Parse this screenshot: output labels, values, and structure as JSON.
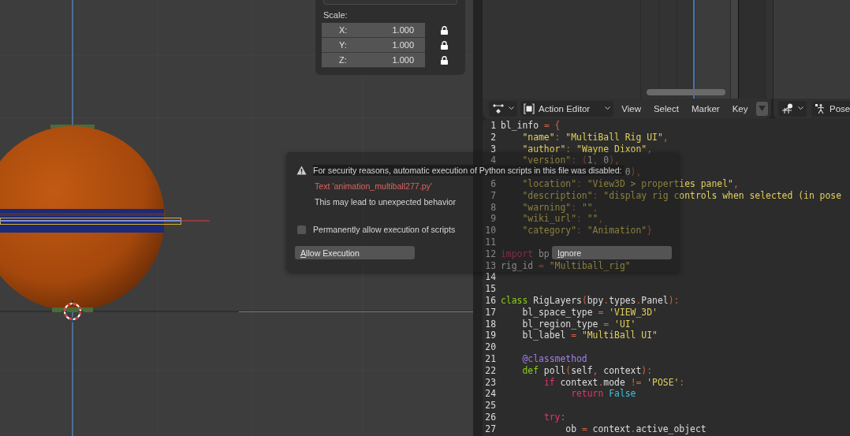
{
  "viewport": {
    "panel": {
      "heading": "Scale:",
      "fields": [
        {
          "axis": "X:",
          "value": "1.000",
          "locked": true
        },
        {
          "axis": "Y:",
          "value": "1.000",
          "locked": true
        },
        {
          "axis": "Z:",
          "value": "1.000",
          "locked": true
        }
      ]
    }
  },
  "dopesheet_header": {
    "editor_mode": "Action Editor",
    "menus": [
      "View",
      "Select",
      "Marker",
      "Key"
    ]
  },
  "pose_header": {
    "mode": "Pose"
  },
  "text_editor": {
    "lines": [
      {
        "number": "1",
        "tokens": [
          {
            "kind": "plain",
            "text": "bl_info "
          },
          {
            "kind": "operator",
            "text": "= {"
          }
        ]
      },
      {
        "number": "2",
        "tokens": [
          {
            "kind": "string",
            "text": "    \"name\""
          },
          {
            "kind": "operator",
            "text": ": "
          },
          {
            "kind": "string",
            "text": "\"MultiBall Rig UI\""
          },
          {
            "kind": "operator",
            "text": ","
          }
        ]
      },
      {
        "number": "3",
        "tokens": [
          {
            "kind": "string",
            "text": "    \"author\""
          },
          {
            "kind": "operator",
            "text": ": "
          },
          {
            "kind": "string",
            "text": "\"Wayne Dixon\""
          },
          {
            "kind": "operator",
            "text": ","
          }
        ]
      },
      {
        "number": "4",
        "tokens": [
          {
            "kind": "string",
            "text": "    \"version\""
          },
          {
            "kind": "operator",
            "text": ": ("
          },
          {
            "kind": "plain",
            "text": "1"
          },
          {
            "kind": "operator",
            "text": ", "
          },
          {
            "kind": "plain",
            "text": "0"
          },
          {
            "kind": "operator",
            "text": "),"
          }
        ]
      },
      {
        "tokens": [
          {
            "kind": "plain",
            "text": "                       0"
          },
          {
            "kind": "operator",
            "text": "),"
          }
        ]
      },
      {
        "number": "6",
        "tokens": [
          {
            "kind": "string",
            "text": "    \"location\""
          },
          {
            "kind": "operator",
            "text": ": "
          },
          {
            "kind": "string",
            "text": "\"View3D > properties panel\""
          },
          {
            "kind": "operator",
            "text": ","
          }
        ]
      },
      {
        "number": "7",
        "tokens": [
          {
            "kind": "string",
            "text": "    \"description\""
          },
          {
            "kind": "operator",
            "text": ": "
          },
          {
            "kind": "string",
            "text": "\"display rig controls when selected (in pose"
          }
        ]
      },
      {
        "number": "8",
        "tokens": [
          {
            "kind": "string",
            "text": "    \"warning\""
          },
          {
            "kind": "operator",
            "text": ": "
          },
          {
            "kind": "string",
            "text": "\"\""
          },
          {
            "kind": "operator",
            "text": ","
          }
        ]
      },
      {
        "number": "9",
        "tokens": [
          {
            "kind": "string",
            "text": "    \"wiki_url\""
          },
          {
            "kind": "operator",
            "text": ": "
          },
          {
            "kind": "string",
            "text": "\"\""
          },
          {
            "kind": "operator",
            "text": ","
          }
        ]
      },
      {
        "number": "10",
        "tokens": [
          {
            "kind": "string",
            "text": "    \"category\""
          },
          {
            "kind": "operator",
            "text": ": "
          },
          {
            "kind": "string",
            "text": "\"Animation\""
          },
          {
            "kind": "operator",
            "text": "}"
          }
        ]
      },
      {
        "number": "11"
      },
      {
        "number": "12",
        "tokens": [
          {
            "kind": "keyword",
            "text": "import"
          },
          {
            "kind": "plain",
            "text": " bp"
          }
        ]
      },
      {
        "number": "13",
        "tokens": [
          {
            "kind": "plain",
            "text": "rig_id "
          },
          {
            "kind": "operator",
            "text": "= "
          },
          {
            "kind": "string",
            "text": "\"Multiball_rig\""
          }
        ]
      },
      {
        "number": "14"
      },
      {
        "number": "15"
      },
      {
        "number": "16",
        "tokens": [
          {
            "kind": "definition",
            "text": "class"
          },
          {
            "kind": "plain",
            "text": " RigLayers"
          },
          {
            "kind": "operator",
            "text": "("
          },
          {
            "kind": "plain",
            "text": "bpy"
          },
          {
            "kind": "operator",
            "text": "."
          },
          {
            "kind": "plain",
            "text": "types"
          },
          {
            "kind": "operator",
            "text": "."
          },
          {
            "kind": "plain",
            "text": "Panel"
          },
          {
            "kind": "operator",
            "text": "):"
          }
        ]
      },
      {
        "number": "17",
        "tokens": [
          {
            "kind": "plain",
            "text": "    bl_space_type "
          },
          {
            "kind": "operator",
            "text": "= "
          },
          {
            "kind": "string",
            "text": "'VIEW_3D'"
          }
        ]
      },
      {
        "number": "18",
        "tokens": [
          {
            "kind": "plain",
            "text": "    bl_region_type "
          },
          {
            "kind": "operator",
            "text": "= "
          },
          {
            "kind": "string",
            "text": "'UI'"
          }
        ]
      },
      {
        "number": "19",
        "tokens": [
          {
            "kind": "plain",
            "text": "    bl_label "
          },
          {
            "kind": "operator",
            "text": "= "
          },
          {
            "kind": "string",
            "text": "\"MultiBall UI\""
          }
        ]
      },
      {
        "number": "20"
      },
      {
        "number": "21",
        "tokens": [
          {
            "kind": "decorator",
            "text": "    @classmethod"
          }
        ]
      },
      {
        "number": "22",
        "tokens": [
          {
            "kind": "definition",
            "text": "    def"
          },
          {
            "kind": "plain",
            "text": " poll"
          },
          {
            "kind": "operator",
            "text": "("
          },
          {
            "kind": "plain",
            "text": "self"
          },
          {
            "kind": "operator",
            "text": ", "
          },
          {
            "kind": "plain",
            "text": "context"
          },
          {
            "kind": "operator",
            "text": "):"
          }
        ]
      },
      {
        "number": "23",
        "tokens": [
          {
            "kind": "keyword",
            "text": "        if"
          },
          {
            "kind": "plain",
            "text": " context"
          },
          {
            "kind": "operator",
            "text": "."
          },
          {
            "kind": "plain",
            "text": "mode "
          },
          {
            "kind": "operator",
            "text": "!= "
          },
          {
            "kind": "string",
            "text": "'POSE'"
          },
          {
            "kind": "operator",
            "text": ":"
          }
        ]
      },
      {
        "number": "24",
        "tokens": [
          {
            "kind": "keyword",
            "text": "             return"
          },
          {
            "kind": "constant",
            "text": " False"
          }
        ]
      },
      {
        "number": "25"
      },
      {
        "number": "26",
        "tokens": [
          {
            "kind": "keyword",
            "text": "        try"
          },
          {
            "kind": "operator",
            "text": ":"
          }
        ]
      },
      {
        "number": "27",
        "tokens": [
          {
            "kind": "plain",
            "text": "            ob "
          },
          {
            "kind": "operator",
            "text": "= "
          },
          {
            "kind": "plain",
            "text": "context"
          },
          {
            "kind": "operator",
            "text": "."
          },
          {
            "kind": "plain",
            "text": "active_object"
          }
        ]
      }
    ]
  },
  "dialog": {
    "message": "For security reasons, automatic execution of Python scripts in this file was disabled:",
    "file": "Text 'animation_multiball277.py'",
    "warning": "This may lead to unexpected behavior",
    "checkbox": {
      "label": "Permanently allow execution of scripts",
      "checked": false
    },
    "buttons": [
      {
        "label": "Allow Execution"
      },
      {
        "label": "Ignore"
      }
    ]
  }
}
